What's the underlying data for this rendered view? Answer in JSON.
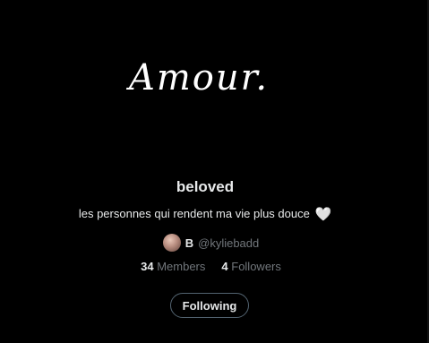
{
  "banner": {
    "text": "Amour."
  },
  "list": {
    "name": "beloved",
    "description": "les personnes qui rendent ma vie plus douce",
    "description_emoji": "🤍"
  },
  "owner": {
    "initial": "B",
    "handle": "@kyliebadd"
  },
  "stats": {
    "members_count": "34",
    "members_label": "Members",
    "followers_count": "4",
    "followers_label": "Followers"
  },
  "actions": {
    "following_label": "Following"
  },
  "colors": {
    "background": "#000000",
    "primary_text": "#e7e9ea",
    "secondary_text": "#71767b",
    "button_border": "#536471"
  }
}
